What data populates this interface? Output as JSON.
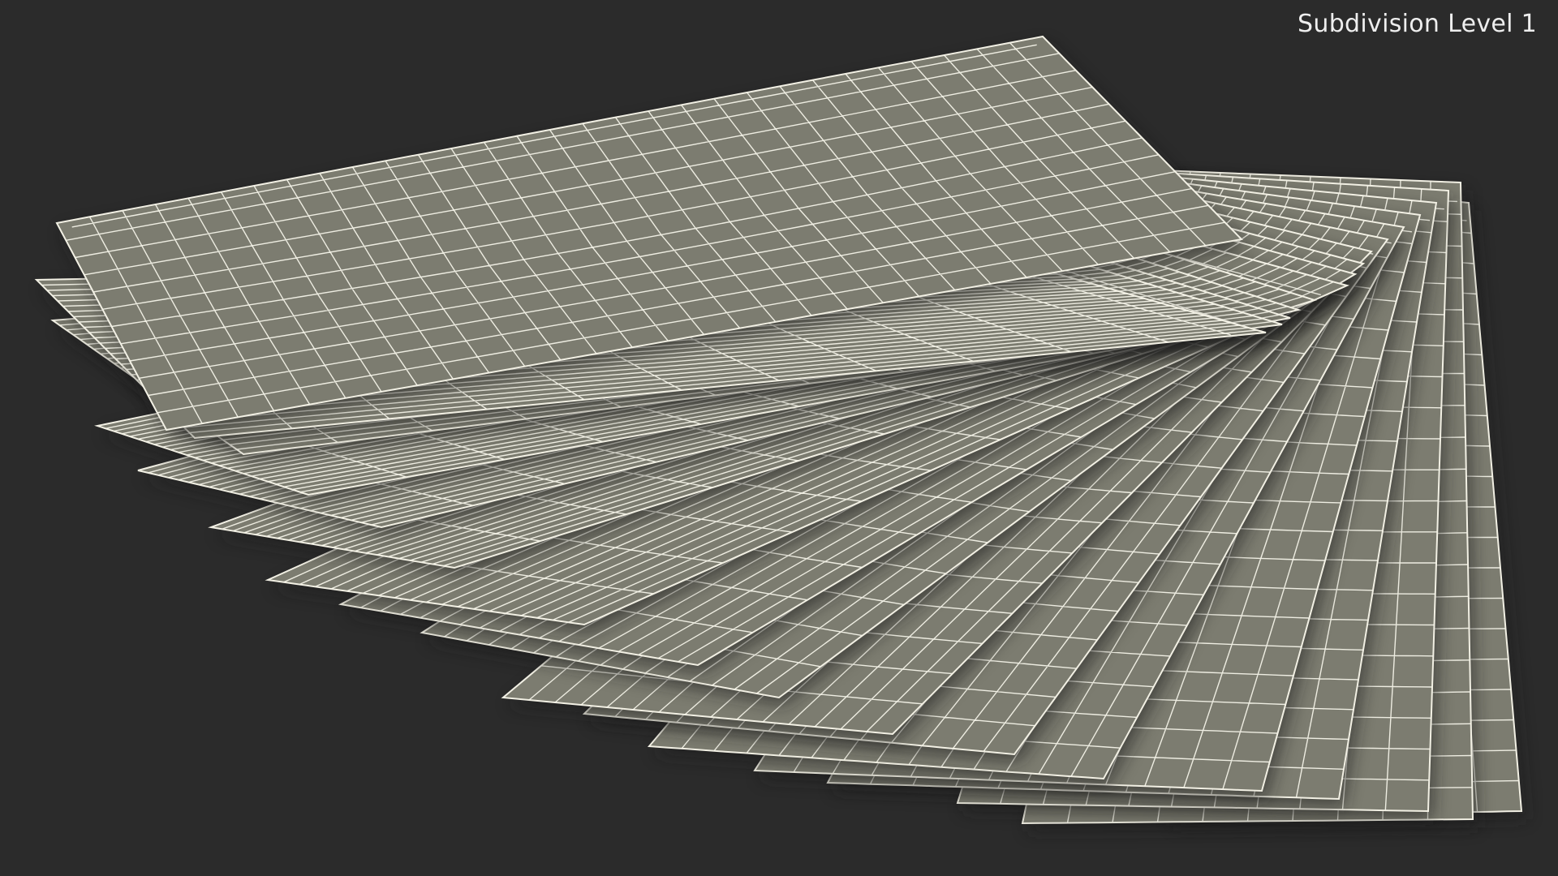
{
  "viewport": {
    "label": "Subdivision Level 1"
  },
  "style": {
    "background": "#2b2b2b",
    "sheet_fill": "#7c7c70",
    "sheet_edge": "#f2f0e4",
    "wire_color": "#f4f3e8",
    "shadow_color": "#1e1e1e"
  },
  "scene": {
    "object": "stack-of-fanned-paper-sheets",
    "display_mode": "wireframe-on-shaded"
  }
}
